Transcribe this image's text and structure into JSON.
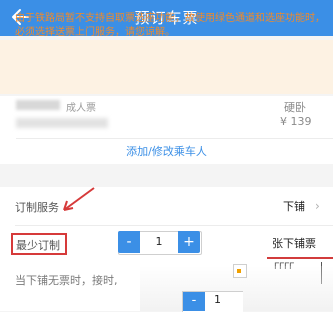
{
  "header": {
    "title": "预订车票"
  },
  "notice": {
    "text": "由于铁路局暂不支持自取票选座功能，故使用绿色通道和选座功能时，必须选择送票上门服务，请您谅解。"
  },
  "passenger": {
    "ticket_type": "成人票",
    "seat_type": "硬卧",
    "price": "¥ 139",
    "add_link": "添加/修改乘车人"
  },
  "service": {
    "label": "订制服务",
    "value": "下铺"
  },
  "minimum": {
    "label": "最少订制",
    "quantity": "1",
    "minus": "-",
    "plus": "+"
  },
  "popup": {
    "label": "张下铺票",
    "deco": "ᒥᒥᒥᒥ"
  },
  "fallback": {
    "text": "当下铺无票时，接时,",
    "quantity": "1",
    "minus": "-"
  },
  "colors": {
    "header_bg": "#3b8fe6",
    "notice_text": "#f08a2a",
    "notice_bg": "#fdf2e3",
    "link": "#3b8fe6",
    "annotation": "#d63a3a"
  }
}
